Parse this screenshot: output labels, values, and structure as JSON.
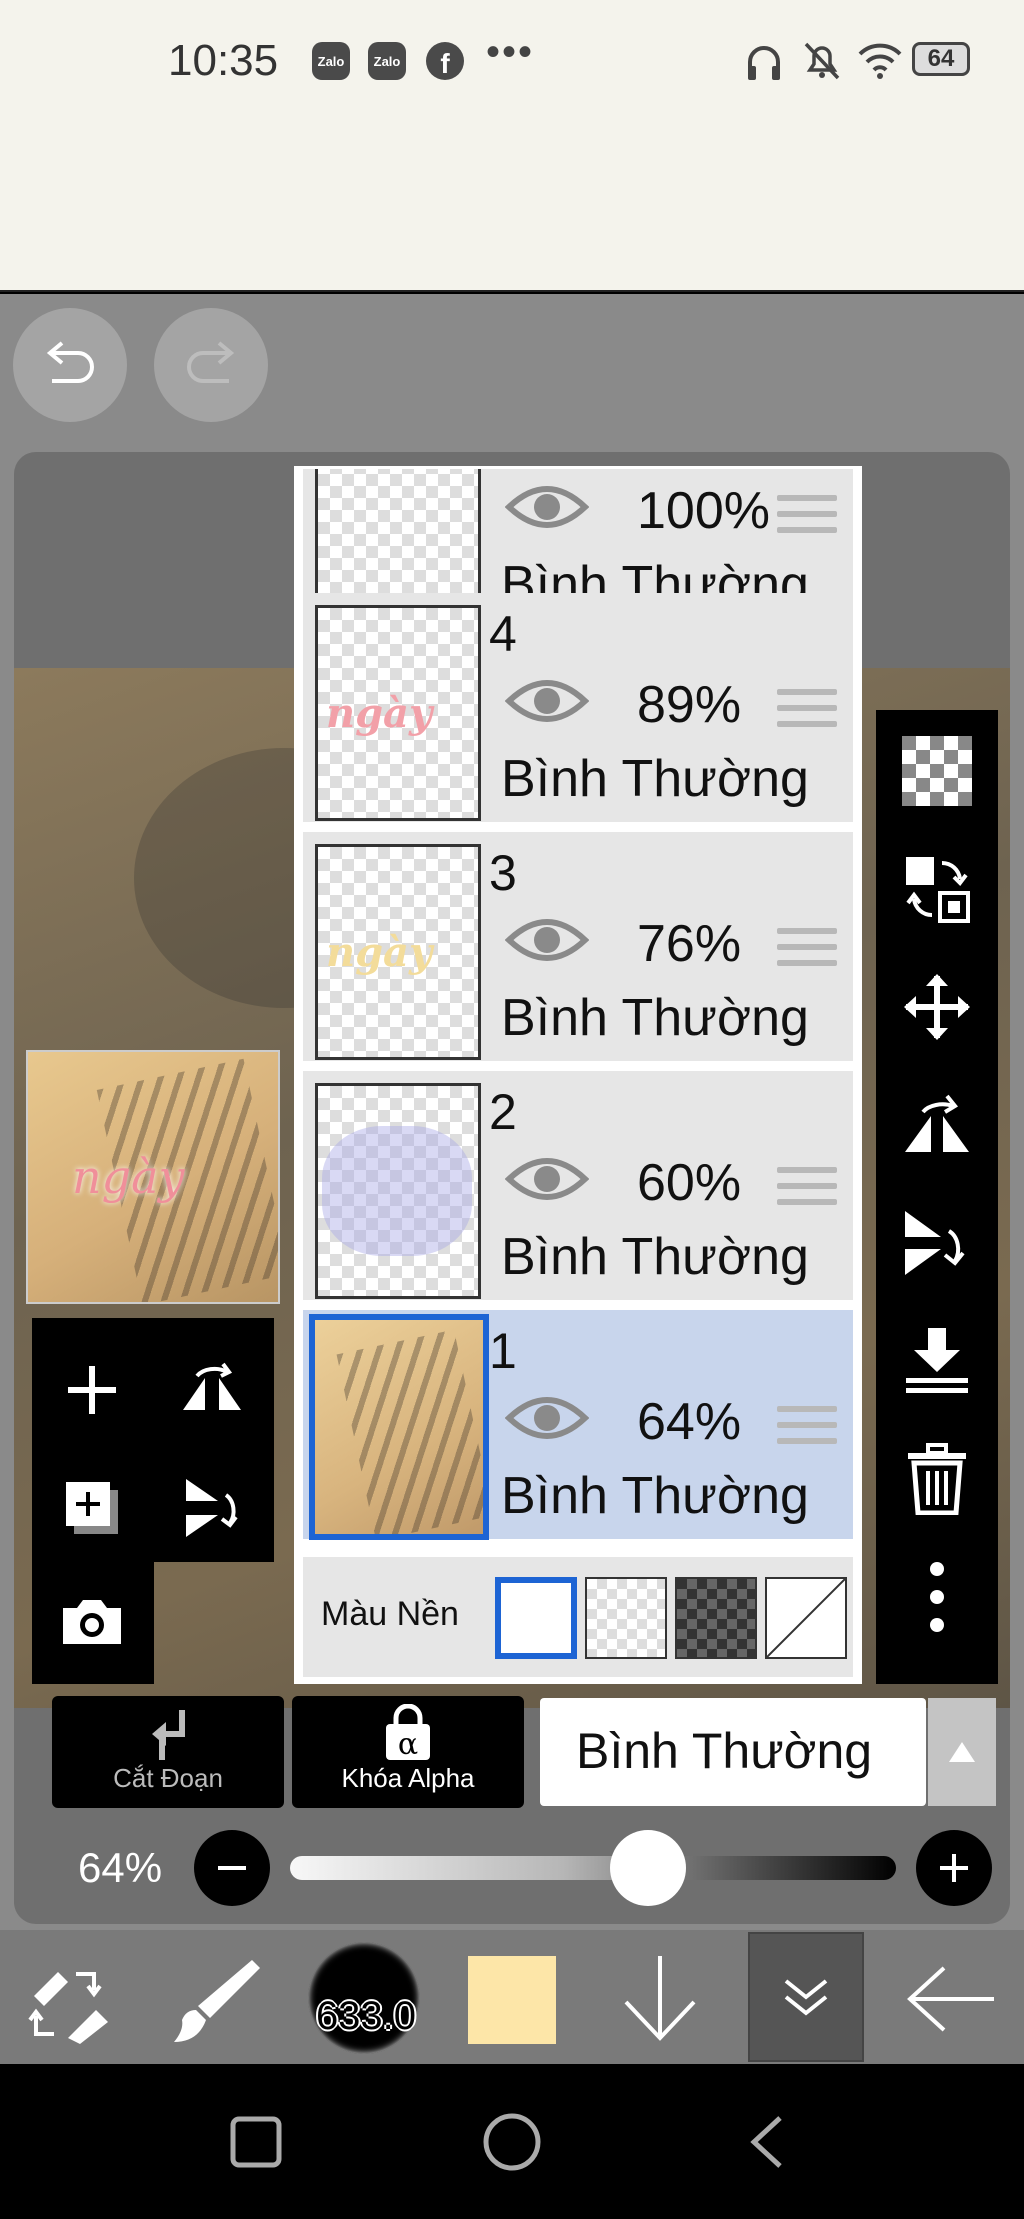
{
  "status_bar": {
    "time": "10:35",
    "notification_icons": [
      "Zalo",
      "Zalo",
      "f"
    ],
    "more": "•••",
    "battery": "64",
    "icons": [
      "headphones-icon",
      "bell-off-icon",
      "wifi-icon",
      "battery-icon"
    ]
  },
  "toolbar_top": {
    "undo": "undo-icon",
    "redo": "redo-icon"
  },
  "canvas": {
    "thumbnail_text": "ngày"
  },
  "layers": [
    {
      "number": "",
      "opacity": "100%",
      "blend": "Bình Thường",
      "partial": true
    },
    {
      "number": "4",
      "opacity": "89%",
      "blend": "Bình Thường",
      "thumb_word": "ngày",
      "thumb_color": "#f2a0a8"
    },
    {
      "number": "3",
      "opacity": "76%",
      "blend": "Bình Thường",
      "thumb_word": "ngày",
      "thumb_color": "#f3dc9a"
    },
    {
      "number": "2",
      "opacity": "60%",
      "blend": "Bình Thường"
    },
    {
      "number": "1",
      "opacity": "64%",
      "blend": "Bình Thường",
      "selected": true
    }
  ],
  "background": {
    "label": "Màu Nền",
    "options": [
      "white",
      "transparent-light",
      "transparent-dark",
      "none"
    ],
    "selected": "white"
  },
  "controls": {
    "cut_label": "Cắt Đoạn",
    "alpha_lock_label": "Khóa Alpha",
    "blend_mode": "Bình Thường",
    "opacity_text": "64%",
    "opacity_value": 0.64
  },
  "bottom_toolbar": {
    "brush_size": "633.0",
    "color": "#fde6a8"
  },
  "colors": {
    "accent": "#1d64d4",
    "selected_row": "#c8d5ec"
  }
}
